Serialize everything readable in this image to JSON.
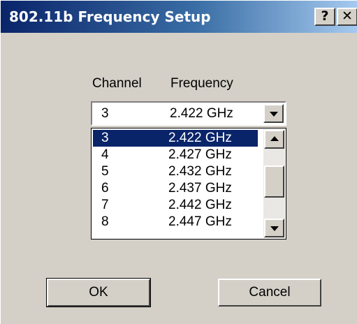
{
  "window": {
    "title": "802.11b Frequency Setup",
    "help_label": "?",
    "close_label": "✕"
  },
  "columns": {
    "channel": "Channel",
    "frequency": "Frequency"
  },
  "combo": {
    "channel": "3",
    "frequency": "2.422 GHz"
  },
  "list": {
    "rows": [
      {
        "channel": "3",
        "frequency": "2.422 GHz",
        "selected": true
      },
      {
        "channel": "4",
        "frequency": "2.427 GHz",
        "selected": false
      },
      {
        "channel": "5",
        "frequency": "2.432 GHz",
        "selected": false
      },
      {
        "channel": "6",
        "frequency": "2.437 GHz",
        "selected": false
      },
      {
        "channel": "7",
        "frequency": "2.442 GHz",
        "selected": false
      },
      {
        "channel": "8",
        "frequency": "2.447 GHz",
        "selected": false
      }
    ]
  },
  "buttons": {
    "ok": "OK",
    "cancel": "Cancel"
  },
  "colors": {
    "title_bar_start": "#0a246a",
    "title_bar_end": "#a6caf0",
    "selection": "#0a246a",
    "face": "#d4d0c8"
  }
}
